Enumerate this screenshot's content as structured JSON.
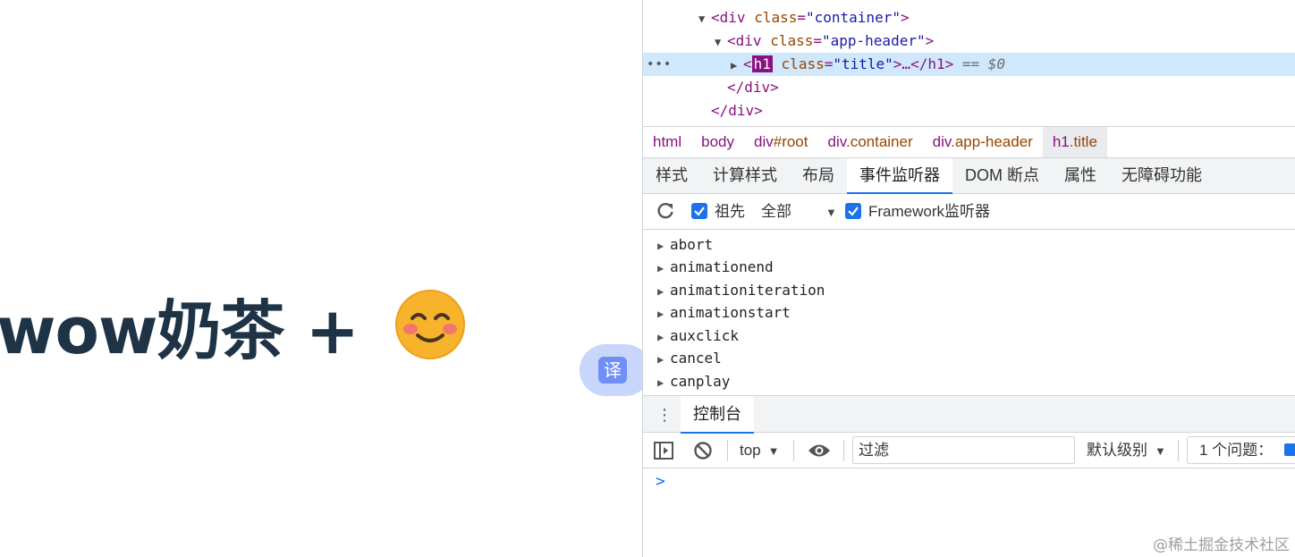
{
  "page": {
    "headline": "wow奶茶 +",
    "emoji_icon": "smiling-face-icon",
    "translate_glyph": "译",
    "colors": {
      "headline": "#1f3346",
      "translate_bg": "#c9d6fb",
      "translate_icon": "#6f8ff5",
      "emoji": "#f5a623"
    }
  },
  "elements_panel": {
    "selected_suffix": "== $0",
    "lines": [
      {
        "open": "<",
        "tag": "div",
        "attr": "class",
        "value": "\"container\"",
        "close": ">"
      },
      {
        "open": "<",
        "tag": "div",
        "attr": "class",
        "value": "\"app-header\"",
        "close": ">"
      },
      {
        "open": "<",
        "tag": "h1",
        "attr": "class",
        "value": "\"title\"",
        "close": ">…</h1>"
      },
      {
        "text": "</div>"
      },
      {
        "text": "</div>"
      }
    ]
  },
  "breadcrumb": [
    {
      "tag": "html",
      "cls": ""
    },
    {
      "tag": "body",
      "cls": ""
    },
    {
      "tag": "div",
      "cls": "#root"
    },
    {
      "tag": "div",
      "cls": ".container"
    },
    {
      "tag": "div",
      "cls": ".app-header"
    },
    {
      "tag": "h1",
      "cls": ".title"
    }
  ],
  "tabs": [
    "样式",
    "计算样式",
    "布局",
    "事件监听器",
    "DOM 断点",
    "属性",
    "无障碍功能"
  ],
  "active_tab": "事件监听器",
  "event_toolbar": {
    "ancestors_label": "祖先",
    "scope_value": "全部",
    "framework_label": "Framework监听器"
  },
  "events": [
    "abort",
    "animationend",
    "animationiteration",
    "animationstart",
    "auxclick",
    "cancel",
    "canplay"
  ],
  "drawer": {
    "console_tab": "控制台"
  },
  "console_toolbar": {
    "context": "top",
    "filter_placeholder": "过滤",
    "level": "默认级别",
    "issues": "1 个问题："
  },
  "console": {
    "prompt": ">"
  },
  "watermark": "@稀土掘金技术社区",
  "colors": {
    "accent": "#1a73e8",
    "tag": "#881280",
    "attr": "#994500",
    "value": "#1a1aa6",
    "selected_row": "#cfe8fc"
  }
}
